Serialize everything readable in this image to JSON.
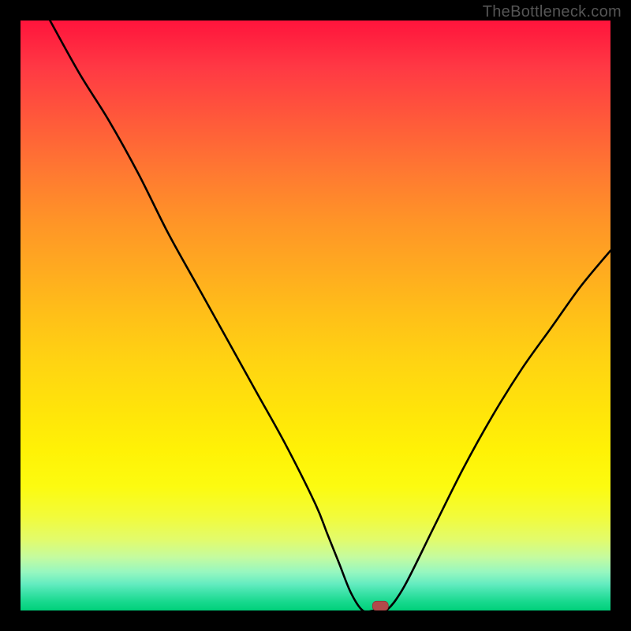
{
  "watermark": "TheBottleneck.com",
  "chart_data": {
    "type": "line",
    "title": "",
    "xlabel": "",
    "ylabel": "",
    "xlim": [
      0,
      100
    ],
    "ylim": [
      0,
      100
    ],
    "grid": false,
    "background": "rainbow-gradient-red-to-green",
    "series": [
      {
        "name": "bottleneck-curve",
        "x": [
          5,
          10,
          15,
          20,
          25,
          30,
          35,
          40,
          45,
          50,
          52,
          54,
          56,
          58,
          60,
          62,
          65,
          70,
          75,
          80,
          85,
          90,
          95,
          100
        ],
        "y": [
          100,
          91,
          83,
          74,
          64,
          55,
          46,
          37,
          28,
          18,
          13,
          8,
          3,
          0,
          0,
          0,
          4,
          14,
          24,
          33,
          41,
          48,
          55,
          61
        ]
      }
    ],
    "marker": {
      "x": 61,
      "y": 0.5,
      "shape": "pill",
      "color": "#b24a4a"
    },
    "colors": {
      "curve": "#000000",
      "marker": "#b24a4a"
    }
  }
}
